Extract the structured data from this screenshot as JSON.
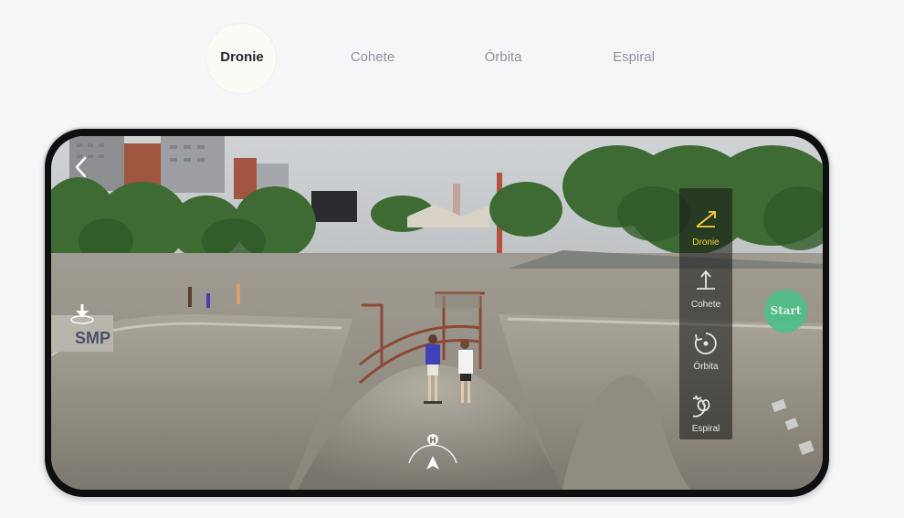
{
  "top_tabs": [
    {
      "label": "Dronie",
      "active": true
    },
    {
      "label": "Cohete",
      "active": false
    },
    {
      "label": "Órbita",
      "active": false
    },
    {
      "label": "Espiral",
      "active": false
    }
  ],
  "mode_panel": {
    "items": [
      {
        "label": "Dronie",
        "icon": "dronie-icon",
        "active": true
      },
      {
        "label": "Cohete",
        "icon": "rocket-icon",
        "active": false
      },
      {
        "label": "Órbita",
        "icon": "orbit-icon",
        "active": false
      },
      {
        "label": "Espiral",
        "icon": "spiral-icon",
        "active": false
      }
    ]
  },
  "start_button": {
    "label": "Start"
  },
  "heading_indicator": {
    "label": "H"
  },
  "scene": {
    "sign_text": "SMP"
  },
  "colors": {
    "accent": "#f5d23a",
    "start": "#4fc08a",
    "active_tab": "#1f2329",
    "inactive_tab": "#8d949c"
  }
}
